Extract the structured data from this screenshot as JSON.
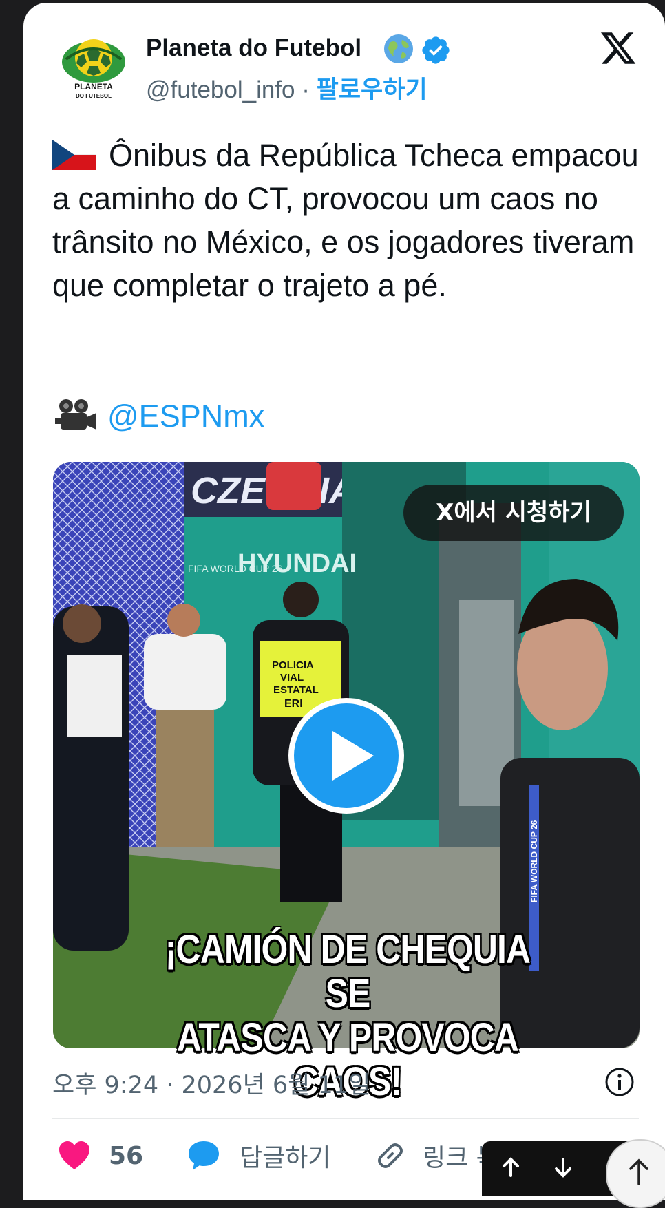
{
  "author": {
    "name": "Planeta do Futebol",
    "handle": "@futebol_info",
    "separator": "·",
    "follow_label": "팔로우하기",
    "logo_top_text": "PLANETA",
    "logo_bottom_text": "DO FUTEBOL"
  },
  "tweet": {
    "text": "Ônibus da República Tcheca empacou a caminho do CT, provocou um caos no trânsito no México, e os jogadores tiveram que completar o trajeto a pé.",
    "credit_mention": "@ESPNmx",
    "flag_icon": "czech-flag-icon",
    "credit_icon": "movie-camera-icon"
  },
  "media": {
    "watch_label": "X에서 시청하기",
    "caption_line1": "¡CAMIÓN DE CHEQUIA SE",
    "caption_line2": "ATASCA Y PROVOCA CAOS!",
    "bus_banner": "CZECHIA",
    "bus_brand": "HYUNDAI",
    "bus_event": "FIFA WORLD CUP 26",
    "vest_text_1": "POLICIA",
    "vest_text_2": "VIAL",
    "vest_text_3": "ESTATAL",
    "vest_text_4": "ERI",
    "lanyard_text": "FIFA WORLD CUP 26"
  },
  "meta": {
    "timestamp": "오후 9:24 · 2026년 6월 11일"
  },
  "actions": {
    "likes": "56",
    "reply_label": "답글하기",
    "link_label": "링크 복"
  },
  "colors": {
    "accent": "#1d9bf0",
    "heart": "#f91880",
    "text": "#0f1419",
    "muted": "#536471"
  }
}
